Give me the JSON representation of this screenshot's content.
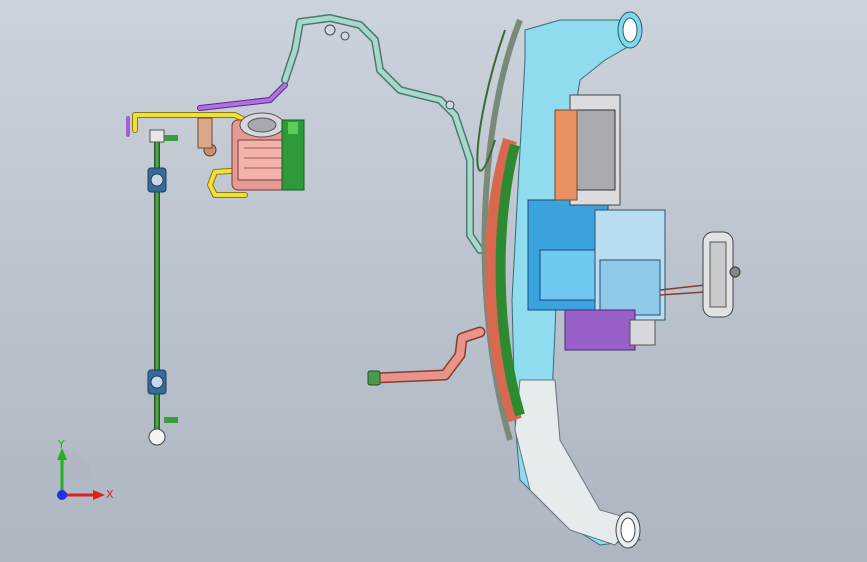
{
  "viewport": {
    "background_top": "#cdd3dc",
    "background_bottom": "#aeb6c2"
  },
  "triad": {
    "x_label": "X",
    "y_label": "Y",
    "x_color": "#e02020",
    "y_color": "#20b020",
    "z_color": "#2030e0"
  },
  "colors": {
    "hvac_cyan": "#7fd8ec",
    "blower_blue": "#3aa2dc",
    "duct_white": "#e6ebee",
    "compressor_pink": "#e49a95",
    "bracket_green": "#2e9a3a",
    "hose_yellow": "#f2e03a",
    "hose_purple": "#a060d0",
    "hose_teal": "#a8d8cc",
    "hose_copper": "#e08070",
    "fan_rim": "#d86850",
    "orange_part": "#e89060"
  }
}
